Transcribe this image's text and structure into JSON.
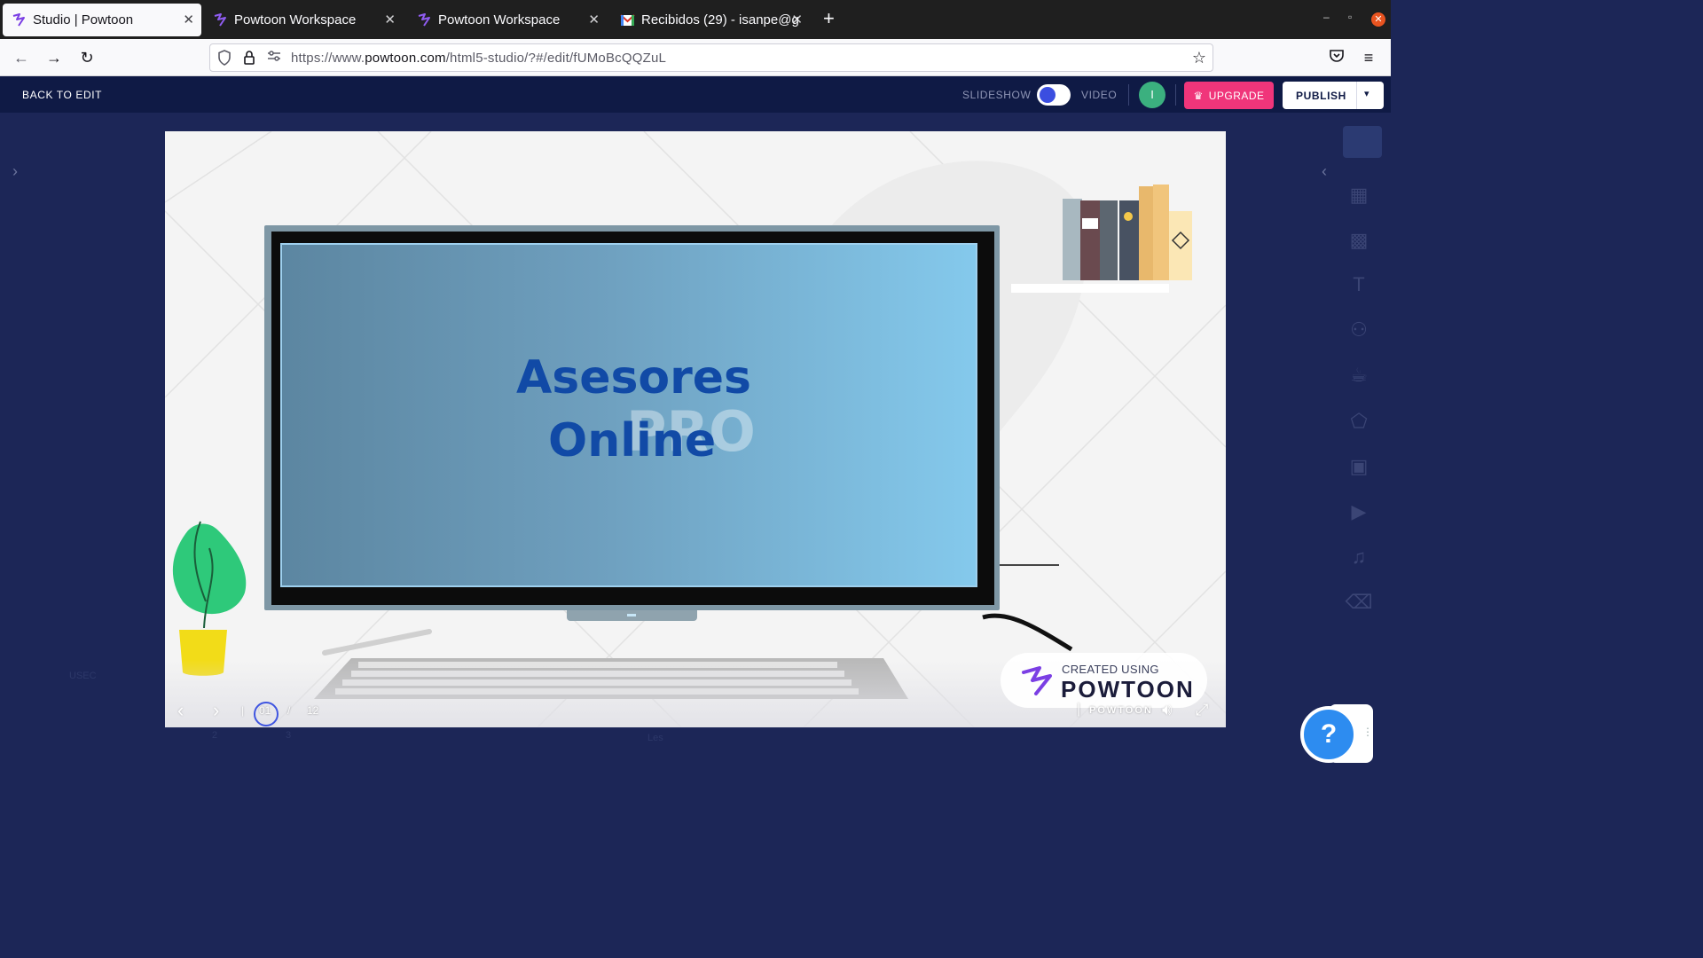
{
  "browser": {
    "tabs": [
      {
        "label": "Studio | Powtoon",
        "active": true
      },
      {
        "label": "Powtoon Workspace",
        "active": false
      },
      {
        "label": "Powtoon Workspace",
        "active": false
      },
      {
        "label": "Recibidos (29) - isanpe@g",
        "active": false
      }
    ],
    "url_prefix": "https://www.",
    "url_domain": "powtoon.com",
    "url_path": "/html5-studio/?#/edit/fUMoBcQQZuL"
  },
  "header": {
    "back_label": "BACK TO EDIT",
    "slideshow_label": "SLIDESHOW",
    "video_label": "VIDEO",
    "avatar_initial": "I",
    "upgrade_label": "UPGRADE",
    "publish_label": "PUBLISH"
  },
  "slide": {
    "title_line1": "Asesores",
    "title_line2": "Online",
    "watermark": "PRO",
    "created_small": "CREATED USING",
    "created_big": "POWTOON",
    "brand_small": "POWTOON"
  },
  "player": {
    "current": "01",
    "separator": "/",
    "total": "12"
  },
  "background_text": {
    "left_label": "USEC",
    "num2": "2",
    "num3": "3",
    "center_label": "Les"
  },
  "help": {
    "label": "?"
  },
  "colors": {
    "accent_pink": "#f0357a",
    "header_navy": "#0f1a45",
    "editor_bg": "#1c2657",
    "title_blue": "#114aa6"
  },
  "icons": [
    "powtoon-tab-icon",
    "gmail-tab-icon",
    "back-icon",
    "forward-icon",
    "reload-icon",
    "shield-icon",
    "lock-icon",
    "permissions-icon",
    "star-icon",
    "pocket-icon",
    "menu-icon",
    "crown-icon",
    "chevron-down-icon",
    "speaker-icon",
    "fullscreen-icon",
    "powtoon-logo-icon"
  ]
}
